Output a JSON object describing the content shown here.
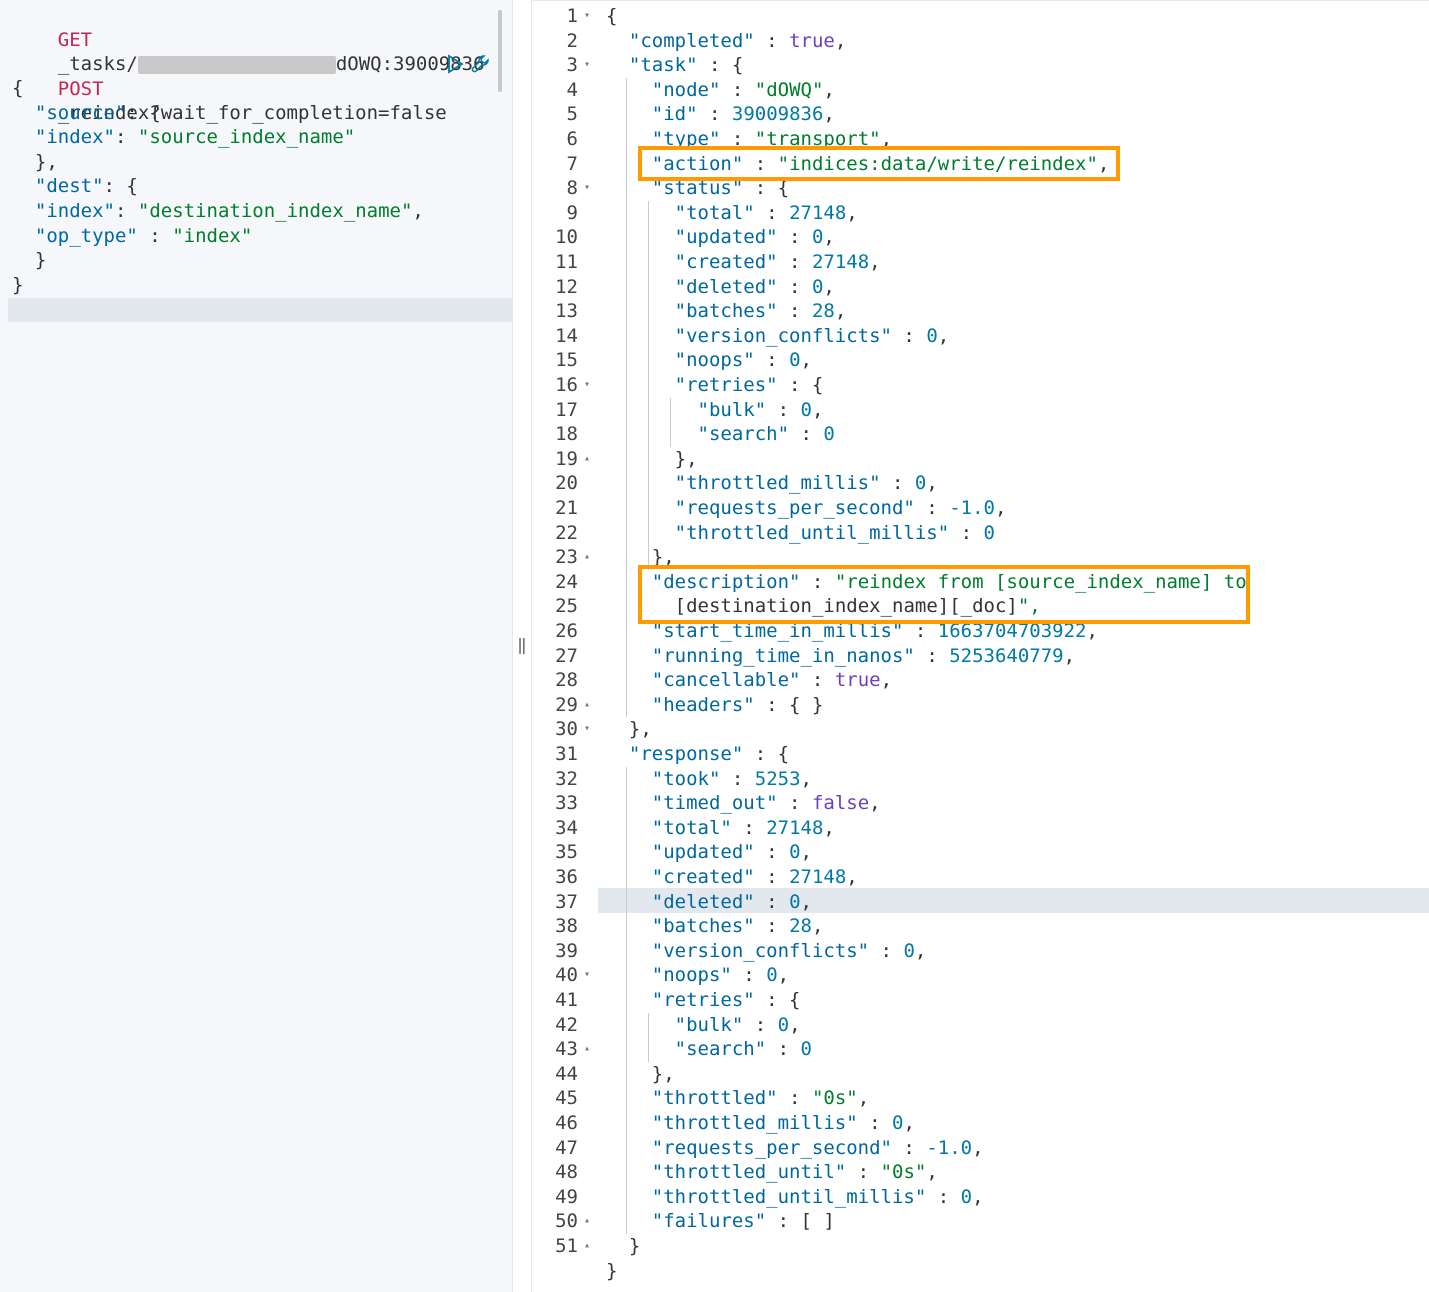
{
  "request": {
    "get_method": "GET",
    "get_path_prefix": "_tasks/",
    "get_path_suffix": "dOWQ:39009836",
    "post_method": "POST",
    "post_path": "_reindex?wait_for_completion=false",
    "body": [
      "{",
      "  \"source\": {",
      "  \"index\": \"source_index_name\"",
      "  },",
      "  \"dest\": {",
      "  \"index\": \"destination_index_name\",",
      "  \"op_type\" : \"index\"",
      "  }",
      "}"
    ]
  },
  "icons": {
    "run": "play-icon",
    "settings": "wrench-icon",
    "resizer": "resize-handle-icon"
  },
  "resizer_glyph": "‖",
  "response": {
    "line_numbers": [
      "1",
      "2",
      "3",
      "4",
      "5",
      "6",
      "7",
      "8",
      "9",
      "10",
      "11",
      "12",
      "13",
      "14",
      "15",
      "16",
      "17",
      "18",
      "19",
      "20",
      "21",
      "22",
      "23",
      "24",
      "25",
      "26",
      "27",
      "28",
      "29",
      "30",
      "31",
      "32",
      "33",
      "34",
      "35",
      "36",
      "37",
      "38",
      "39",
      "40",
      "41",
      "42",
      "43",
      "44",
      "45",
      "46",
      "47",
      "48",
      "49",
      "50",
      "51"
    ],
    "lines": [
      "{",
      "  \"completed\" : true,",
      "  \"task\" : {",
      "    \"node\" : \"dOWQ\",",
      "    \"id\" : 39009836,",
      "    \"type\" : \"transport\",",
      "    \"action\" : \"indices:data/write/reindex\",",
      "    \"status\" : {",
      "      \"total\" : 27148,",
      "      \"updated\" : 0,",
      "      \"created\" : 27148,",
      "      \"deleted\" : 0,",
      "      \"batches\" : 28,",
      "      \"version_conflicts\" : 0,",
      "      \"noops\" : 0,",
      "      \"retries\" : {",
      "        \"bulk\" : 0,",
      "        \"search\" : 0",
      "      },",
      "      \"throttled_millis\" : 0,",
      "      \"requests_per_second\" : -1.0,",
      "      \"throttled_until_millis\" : 0",
      "    },",
      "    \"description\" : \"reindex from [source_index_name] to",
      "      [destination_index_name][_doc]\",",
      "    \"start_time_in_millis\" : 1663704703922,",
      "    \"running_time_in_nanos\" : 5253640779,",
      "    \"cancellable\" : true,",
      "    \"headers\" : { }",
      "  },",
      "  \"response\" : {",
      "    \"took\" : 5253,",
      "    \"timed_out\" : false,",
      "    \"total\" : 27148,",
      "    \"updated\" : 0,",
      "    \"created\" : 27148,",
      "    \"deleted\" : 0,",
      "    \"batches\" : 28,",
      "    \"version_conflicts\" : 0,",
      "    \"noops\" : 0,",
      "    \"retries\" : {",
      "      \"bulk\" : 0,",
      "      \"search\" : 0",
      "    },",
      "    \"throttled\" : \"0s\",",
      "    \"throttled_millis\" : 0,",
      "    \"requests_per_second\" : -1.0,",
      "    \"throttled_until\" : \"0s\",",
      "    \"throttled_until_millis\" : 0,",
      "    \"failures\" : [ ]",
      "  }",
      "}"
    ]
  },
  "colors": {
    "highlight_box": "#ff9a00",
    "key": "#00679e",
    "string": "#007d2c",
    "number": "#0079a5",
    "boolean": "#6b3fc1",
    "method": "#c7254e"
  }
}
